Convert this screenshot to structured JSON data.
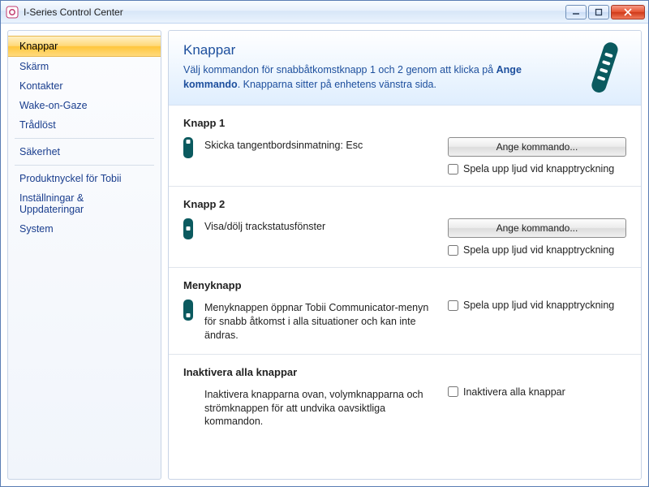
{
  "window": {
    "title": "I-Series Control Center"
  },
  "sidebar": {
    "items": [
      {
        "label": "Knappar",
        "active": true
      },
      {
        "label": "Skärm"
      },
      {
        "label": "Kontakter"
      },
      {
        "label": "Wake-on-Gaze"
      },
      {
        "label": "Trådlöst"
      },
      {
        "label": "Säkerhet"
      },
      {
        "label": "Produktnyckel för Tobii"
      },
      {
        "label": "Inställningar & Uppdateringar"
      },
      {
        "label": "System"
      }
    ]
  },
  "header": {
    "title": "Knappar",
    "desc_pre": "Välj kommandon för snabbåtkomstknapp 1 och 2 genom att klicka på ",
    "desc_bold": "Ange kommando",
    "desc_post": ". Knapparna sitter på enhetens vänstra sida."
  },
  "section1": {
    "title": "Knapp 1",
    "current": "Skicka tangentbordsinmatning: Esc",
    "assign_label": "Ange kommando...",
    "play_sound_label": "Spela upp ljud vid knapptryckning"
  },
  "section2": {
    "title": "Knapp 2",
    "current": "Visa/dölj trackstatusfönster",
    "assign_label": "Ange kommando...",
    "play_sound_label": "Spela upp ljud vid knapptryckning"
  },
  "section_menu": {
    "title": "Menyknapp",
    "desc": "Menyknappen öppnar Tobii Communicator-menyn för snabb åtkomst i alla situationer och kan inte ändras.",
    "play_sound_label": "Spela upp ljud vid knapptryckning"
  },
  "section_disable": {
    "title": "Inaktivera alla knappar",
    "desc": "Inaktivera knapparna ovan, volymknapparna och strömknappen för att undvika oavsiktliga kommandon.",
    "checkbox_label": "Inaktivera alla knappar"
  }
}
